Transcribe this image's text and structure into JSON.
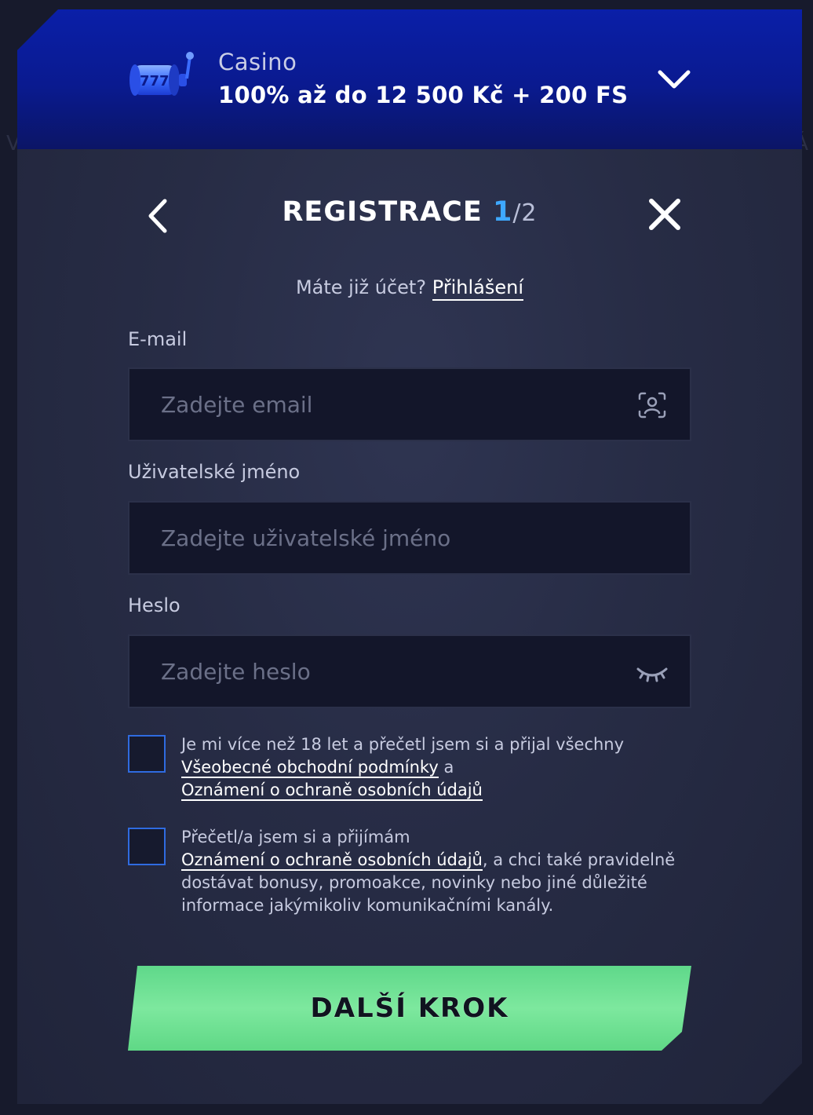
{
  "bonus": {
    "category": "Casino",
    "title": "100% až do 12 500 Kč + 200 FS",
    "icon": "slot-machine-icon",
    "expand_icon": "chevron-down-icon"
  },
  "header": {
    "title": "REGISTRACE",
    "step_current": "1",
    "step_total": "/2",
    "back_icon": "chevron-left-icon",
    "close_icon": "close-icon"
  },
  "login": {
    "prompt": "Máte již účet?",
    "link": "Přihlášení"
  },
  "fields": {
    "email": {
      "label": "E-mail",
      "placeholder": "Zadejte email",
      "value": ""
    },
    "username": {
      "label": "Uživatelské jméno",
      "placeholder": "Zadejte uživatelské jméno",
      "value": ""
    },
    "password": {
      "label": "Heslo",
      "placeholder": "Zadejte heslo",
      "value": ""
    }
  },
  "consents": {
    "age": {
      "text_before": "Je mi více než 18 let a přečetl jsem si a přijal všechny",
      "link1": "Všeobecné obchodní podmínky",
      "connector": " a",
      "link2": "Oznámení o ochraně osobních údajů",
      "checked": false
    },
    "marketing": {
      "text_before": "Přečetl/a jsem si a přijímám",
      "link": "Oznámení o ochraně osobních údajů",
      "text_after": ", a chci také pravidelně dostávat bonusy, promoakce, novinky nebo jiné důležité informace jakýmikoliv komunikačními kanály.",
      "checked": false
    }
  },
  "next_button": {
    "label": "DALŠÍ KROK"
  },
  "colors": {
    "accent_blue": "#3ea8ff",
    "header_blue": "#0a1fa8",
    "button_green": "#6ee394",
    "panel": "#272c45"
  }
}
